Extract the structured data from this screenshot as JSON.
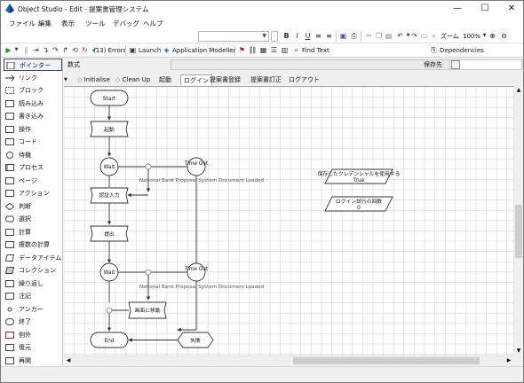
{
  "window": {
    "title": "Object Studio - Edit - 提案書管理システム",
    "minimize_glyph": "—",
    "maximize_glyph": "☐",
    "close_glyph": "✕"
  },
  "menu": [
    "ファイル",
    "編集",
    "表示",
    "ツール",
    "デバッグ",
    "ヘルプ"
  ],
  "toolbar": {
    "font_combo_value": "",
    "size_combo_value": "",
    "bold": "B",
    "italic": "I",
    "underline": "U",
    "zoom_label": "ズーム",
    "zoom_value": "100%"
  },
  "toolbar2": {
    "errors": "(13) Errors",
    "launch": "Launch",
    "app_modeller": "Application Modeller",
    "find_text": "Find Text",
    "dependencies": "Dependencies"
  },
  "palette": [
    {
      "label": "ポインター",
      "icon": "pointer-icon",
      "selected": true
    },
    {
      "label": "リンク",
      "icon": "link-icon"
    },
    {
      "label": "ブロック",
      "icon": "block-icon"
    },
    {
      "label": "読み込み",
      "icon": "read-icon"
    },
    {
      "label": "書き込み",
      "icon": "write-icon"
    },
    {
      "label": "操作",
      "icon": "navigate-icon"
    },
    {
      "label": "コード",
      "icon": "code-icon"
    },
    {
      "label": "待機",
      "icon": "wait-icon"
    },
    {
      "label": "プロセス",
      "icon": "process-icon"
    },
    {
      "label": "ページ",
      "icon": "page-icon"
    },
    {
      "label": "アクション",
      "icon": "action-icon"
    },
    {
      "label": "判断",
      "icon": "decision-icon"
    },
    {
      "label": "選択",
      "icon": "choice-icon"
    },
    {
      "label": "計算",
      "icon": "calculation-icon"
    },
    {
      "label": "複数の計算",
      "icon": "multi-calculation-icon"
    },
    {
      "label": "データアイテム",
      "icon": "data-item-icon"
    },
    {
      "label": "コレクション",
      "icon": "collection-icon"
    },
    {
      "label": "繰り返し",
      "icon": "loop-icon"
    },
    {
      "label": "注記",
      "icon": "note-icon"
    },
    {
      "label": "アンカー",
      "icon": "anchor-icon"
    },
    {
      "label": "終了",
      "icon": "end-icon"
    },
    {
      "label": "例外",
      "icon": "exception-icon"
    },
    {
      "label": "復元",
      "icon": "recover-icon"
    },
    {
      "label": "再開",
      "icon": "resume-icon"
    }
  ],
  "formula_bar": {
    "label": "数式",
    "store_in_label": "保存先",
    "value": ""
  },
  "tabs": [
    {
      "label": "Initialise",
      "icon": true
    },
    {
      "label": "Clean Up",
      "icon": true
    },
    {
      "label": "起動"
    },
    {
      "label": "ログイン",
      "active": true
    },
    {
      "label": "提案書登録"
    },
    {
      "label": "提案書訂正"
    },
    {
      "label": "ログアウト"
    }
  ],
  "diagram": {
    "start": "Start",
    "launch_page": "起動",
    "wait": "Wait",
    "timeout": "Time Out",
    "loaded_note": "National Bank Proposal System Document Loaded",
    "login_input": "認証入力",
    "submit": "提出",
    "wait2": "Wait",
    "timeout2": "Time Out",
    "loaded_note2": "National Bank Proposal System Document Loaded",
    "move_page": "画面に移動",
    "end": "End",
    "fail": "失敗",
    "data_item1_name": "保存したクレデンシャルを使用する",
    "data_item1_value": "True",
    "data_item2_name": "ログイン試行の回数",
    "data_item2_value": "0"
  }
}
